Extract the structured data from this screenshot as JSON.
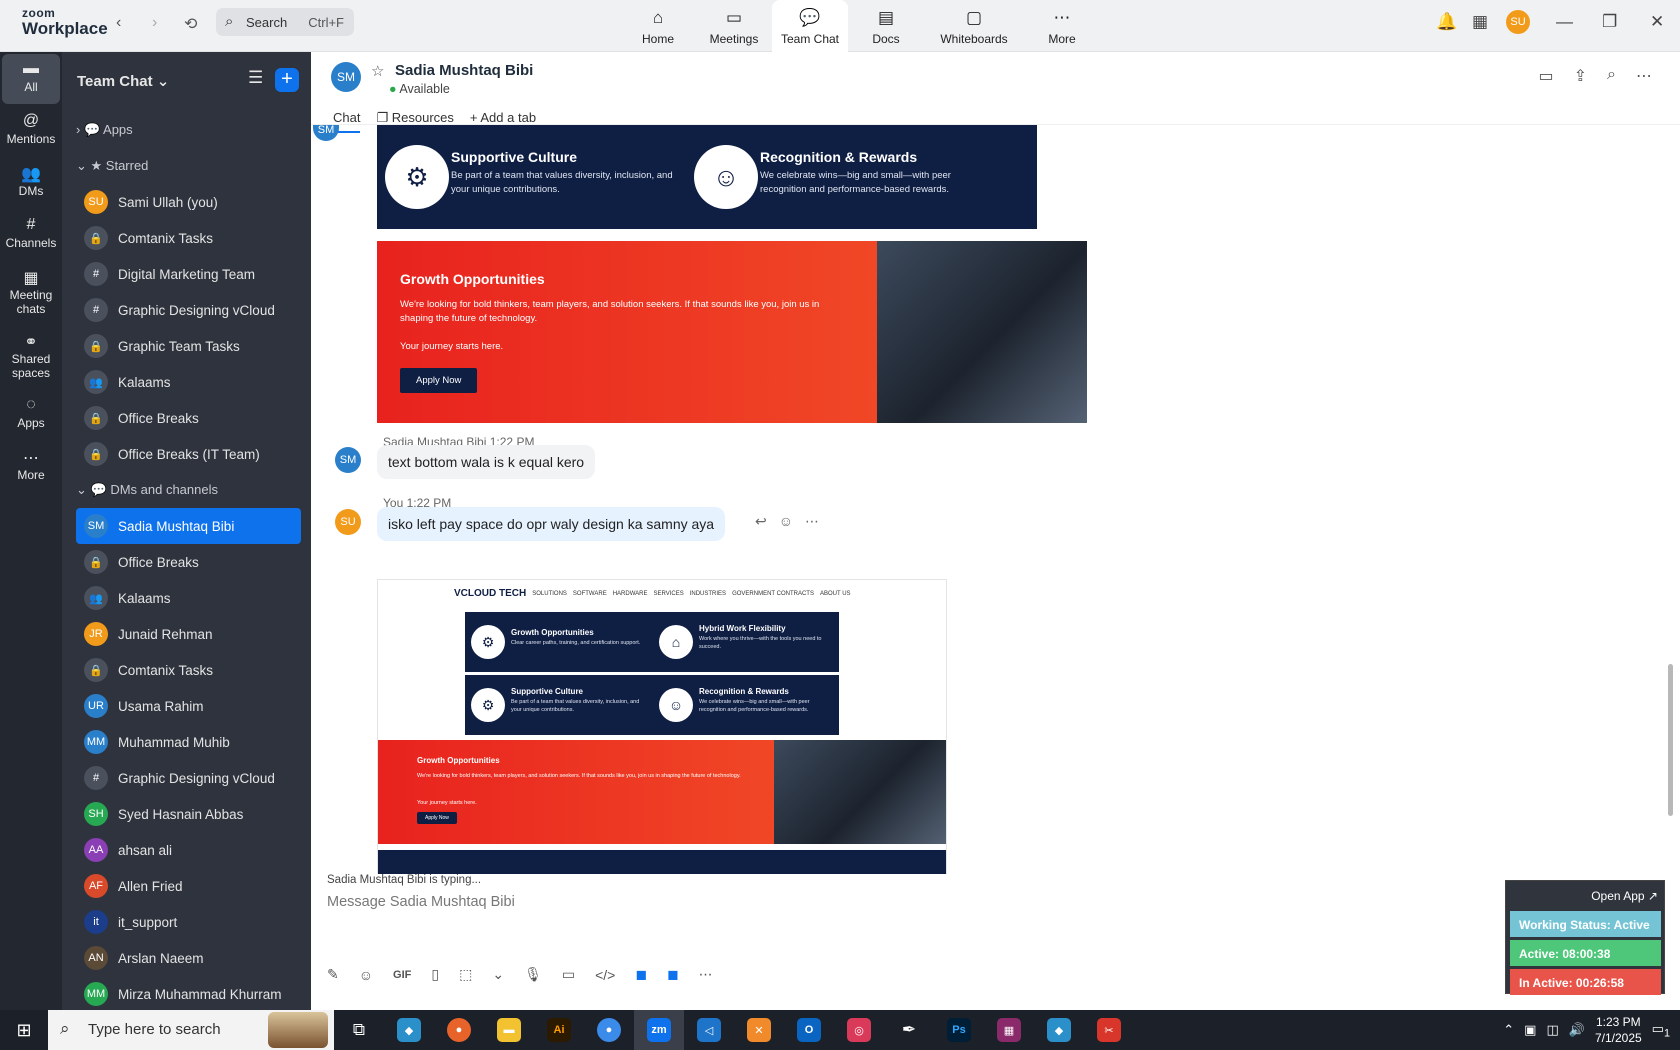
{
  "app": {
    "brand_small": "zoom",
    "brand": "Workplace"
  },
  "search": {
    "label": "Search",
    "shortcut": "Ctrl+F"
  },
  "top_tabs": [
    {
      "label": "Home",
      "icon": "home-icon"
    },
    {
      "label": "Meetings",
      "icon": "video-icon"
    },
    {
      "label": "Team Chat",
      "icon": "chat-icon"
    },
    {
      "label": "Docs",
      "icon": "doc-icon"
    },
    {
      "label": "Whiteboards",
      "icon": "whiteboard-icon"
    },
    {
      "label": "More",
      "icon": "more-icon"
    }
  ],
  "user": {
    "initials": "SU",
    "color": "#f29b1a"
  },
  "rail": [
    {
      "label": "All"
    },
    {
      "label": "Mentions"
    },
    {
      "label": "DMs"
    },
    {
      "label": "Channels"
    },
    {
      "label": "Meeting chats"
    },
    {
      "label": "Shared spaces"
    },
    {
      "label": "Apps"
    },
    {
      "label": "More"
    }
  ],
  "sidebar": {
    "title": "Team Chat",
    "sections": {
      "apps": "Apps",
      "starred": "Starred",
      "dms": "DMs and channels"
    },
    "starred": [
      {
        "label": "Sami Ullah (you)",
        "badge": "SU",
        "color": "#f29b1a"
      },
      {
        "label": "Comtanix Tasks",
        "badge": "🔒"
      },
      {
        "label": "Digital Marketing Team",
        "badge": "#"
      },
      {
        "label": "Graphic Designing vCloud",
        "badge": "#"
      },
      {
        "label": "Graphic Team Tasks",
        "badge": "🔒"
      },
      {
        "label": "Kalaams",
        "badge": "👥"
      },
      {
        "label": "Office Breaks",
        "badge": "🔒"
      },
      {
        "label": "Office Breaks (IT Team)",
        "badge": "🔒"
      }
    ],
    "dms": [
      {
        "label": "Sadia Mushtaq Bibi",
        "badge": "SM",
        "color": "#2a7fcb"
      },
      {
        "label": "Office Breaks",
        "badge": "🔒"
      },
      {
        "label": "Kalaams",
        "badge": "👥"
      },
      {
        "label": "Junaid Rehman",
        "badge": "JR",
        "color": "#f29b1a"
      },
      {
        "label": "Comtanix Tasks",
        "badge": "🔒"
      },
      {
        "label": "Usama Rahim",
        "badge": "UR",
        "color": "#2a7fcb"
      },
      {
        "label": "Muhammad Muhib",
        "badge": "MM",
        "color": "#2a7fcb"
      },
      {
        "label": "Graphic Designing vCloud",
        "badge": "#"
      },
      {
        "label": "Syed Hasnain Abbas",
        "badge": "SH",
        "color": "#27a852"
      },
      {
        "label": "ahsan ali",
        "badge": "AA",
        "color": "#8a3fb4"
      },
      {
        "label": "Allen Fried",
        "badge": "AF",
        "color": "#d84a2a"
      },
      {
        "label": "it_support",
        "badge": "it",
        "color": "#1c3d8a"
      },
      {
        "label": "Arslan Naeem",
        "badge": "AN",
        "color": "#5b4a36"
      },
      {
        "label": "Mirza Muhammad Khurram",
        "badge": "MM",
        "color": "#27a852"
      }
    ]
  },
  "chat": {
    "name": "Sadia Mushtaq Bibi",
    "initials": "SM",
    "status": "Available",
    "tabs": [
      "Chat",
      "Resources",
      "Add a tab"
    ],
    "banner1": {
      "t1": "Supportive Culture",
      "d1": "Be part of a team that values diversity, inclusion, and your unique contributions.",
      "t2": "Recognition & Rewards",
      "d2": "We celebrate wins—big and small—with peer recognition and performance-based rewards."
    },
    "banner2": {
      "title": "Growth Opportunities",
      "desc": "We're looking for bold thinkers, team players, and solution seekers. If that sounds like you, join us in shaping the future of technology.",
      "cta_text": "Your journey starts here.",
      "button": "Apply Now"
    },
    "msg1": {
      "sender": "Sadia Mushtaq Bibi",
      "time": "1:22 PM",
      "text": "text bottom wala is k equal kero"
    },
    "msg2": {
      "sender": "You",
      "time": "1:22 PM",
      "text": "isko left pay space do opr waly design ka samny aya"
    },
    "thumb": {
      "logo": "VCLOUD TECH",
      "nav": [
        "SOLUTIONS",
        "SOFTWARE",
        "HARDWARE",
        "SERVICES",
        "INDUSTRIES",
        "GOVERNMENT CONTRACTS",
        "ABOUT US"
      ],
      "c1": "Growth Opportunities",
      "c1d": "Clear career paths, training, and certification support.",
      "c2": "Hybrid Work Flexibility",
      "c2d": "Work where you thrive—with the tools you need to succeed.",
      "c3": "Supportive Culture",
      "c3d": "Be part of a team that values diversity, inclusion, and your unique contributions.",
      "c4": "Recognition & Rewards",
      "c4d": "We celebrate wins—big and small—with peer recognition and performance-based rewards.",
      "red_title": "Growth Opportunities",
      "red_desc": "We're looking for bold thinkers, team players, and solution seekers. If that sounds like you, join us in shaping the future of technology.",
      "red_cta": "Your journey starts here.",
      "red_btn": "Apply Now"
    },
    "typing": "Sadia Mushtaq Bibi  is typing...",
    "placeholder": "Message Sadia Mushtaq Bibi"
  },
  "status_widget": {
    "open": "Open App ↗",
    "working": "Working Status: Active",
    "active": "Active: 08:00:38",
    "inactive": "In Active: 00:26:58"
  },
  "taskbar": {
    "search": "Type here to search",
    "time": "1:23 PM",
    "date": "7/1/2025",
    "notif": "1"
  }
}
